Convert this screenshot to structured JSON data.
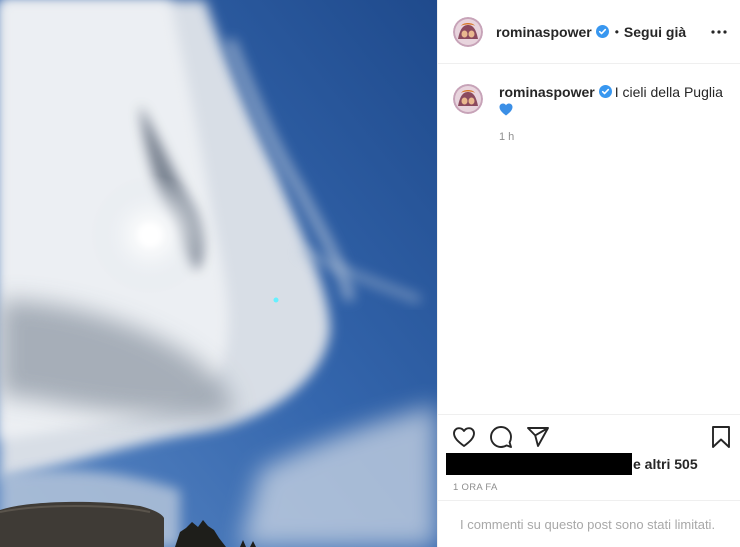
{
  "header": {
    "username": "rominaspower",
    "separator": "•",
    "follow_label": "Segui già"
  },
  "caption": {
    "username": "rominaspower",
    "text": "I cieli della Puglia",
    "emoji": "blue-heart-emoji",
    "time": "1 h"
  },
  "engagement": {
    "likes_suffix": "e altri 505",
    "posted": "1 ORA FA",
    "comments_limited": "I commenti su questo post sono stati limitati."
  },
  "icons": {
    "verified": "verified-badge-icon",
    "more": "more-options-icon",
    "like": "heart-icon",
    "comment": "comment-icon",
    "share": "paper-plane-icon",
    "save": "bookmark-icon"
  },
  "colors": {
    "verified_blue": "#3897f0",
    "text_primary": "#262626",
    "text_secondary": "#8e8e8e",
    "sky": "#2e5ea3",
    "emoji_heart": "#3b8fe6"
  },
  "photo": {
    "subject": "cloudy blue sky with sun, tree and stone wall silhouettes"
  }
}
